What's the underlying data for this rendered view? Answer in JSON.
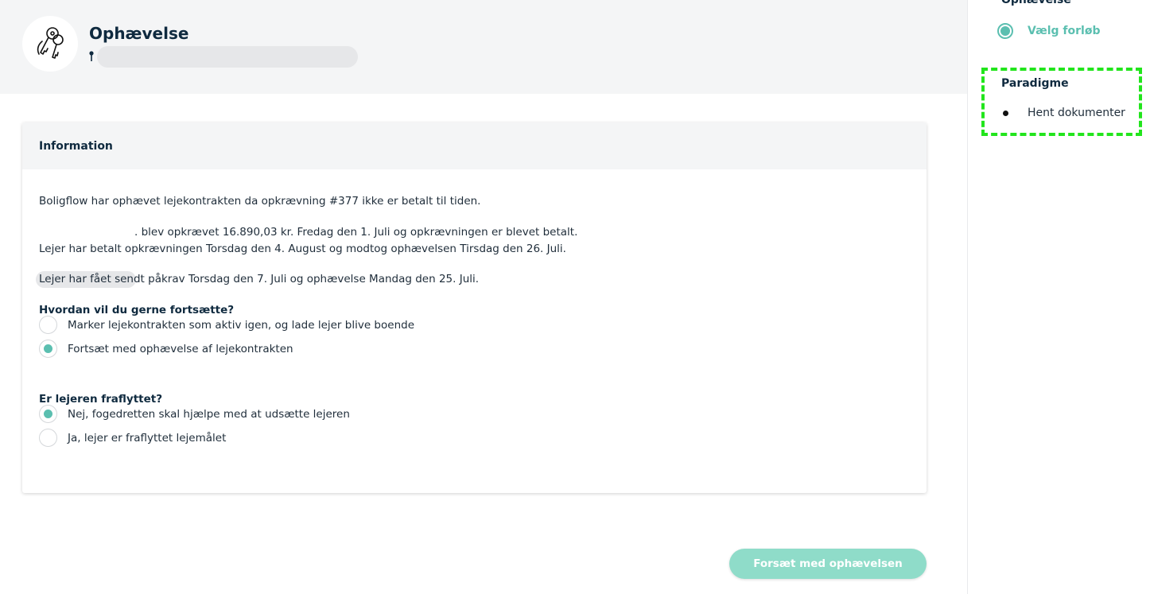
{
  "header": {
    "title": "Ophævelse"
  },
  "card": {
    "title": "Information",
    "paragraph1": "Boligflow har ophævet lejekontrakten da opkrævning #377 ikke er betalt til tiden.",
    "paragraph2_line1": ". blev opkrævet 16.890,03 kr. Fredag den 1. Juli og opkrævningen er blevet betalt.",
    "paragraph2_line2": "Lejer har betalt opkrævningen Torsdag den 4. August og modtog ophævelsen Tirsdag den 26. Juli.",
    "paragraph3": "Lejer har fået sendt påkrav Torsdag den 7. Juli og ophævelse Mandag den 25. Juli.",
    "question1": {
      "label": "Hvordan vil du gerne fortsætte?",
      "options": [
        {
          "label": "Marker lejekontrakten som aktiv igen, og lade lejer blive boende",
          "selected": false
        },
        {
          "label": "Fortsæt med ophævelse af lejekontrakten",
          "selected": true
        }
      ]
    },
    "question2": {
      "label": "Er lejeren fraflyttet?",
      "options": [
        {
          "label": "Nej, fogedretten skal hjælpe med at udsætte lejeren",
          "selected": true
        },
        {
          "label": "Ja, lejer er fraflyttet lejemålet",
          "selected": false
        }
      ]
    }
  },
  "actions": {
    "continue_label": "Forsæt med ophævelsen"
  },
  "sidebar": {
    "section1_title": "Ophævelse",
    "section1_step": "Vælg forløb",
    "section2_title": "Paradigme",
    "section2_step": "Hent dokumenter"
  },
  "colors": {
    "accent": "#5bbfb0",
    "button": "#8fdcc9",
    "highlight": "#22e51c"
  },
  "icons": {
    "avatar": "keys-icon",
    "location": "pin-icon"
  }
}
